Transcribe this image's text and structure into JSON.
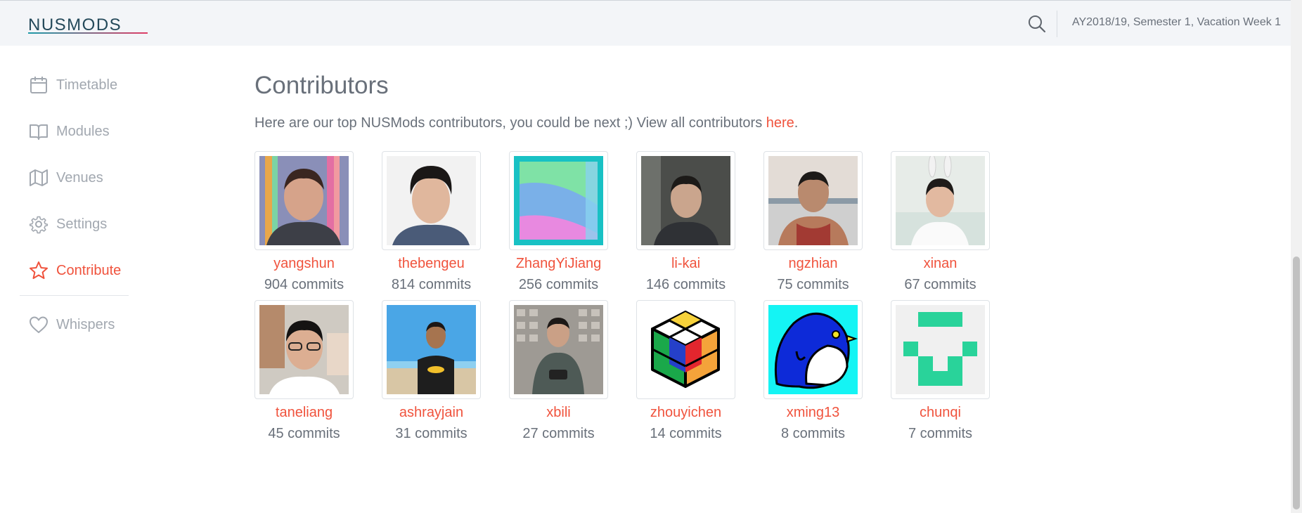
{
  "brand": {
    "logo_text": "NUSMODS",
    "accent": "#f0533d",
    "logo_gradient": [
      "#1e9aa8",
      "#e03d66"
    ]
  },
  "header": {
    "semester": "AY2018/19, Semester 1, Vacation Week 1",
    "search_icon": "search-icon"
  },
  "sidebar": {
    "items": [
      {
        "label": "Timetable",
        "icon": "calendar-icon",
        "active": false
      },
      {
        "label": "Modules",
        "icon": "book-icon",
        "active": false
      },
      {
        "label": "Venues",
        "icon": "map-icon",
        "active": false
      },
      {
        "label": "Settings",
        "icon": "gear-icon",
        "active": false
      },
      {
        "label": "Contribute",
        "icon": "star-icon",
        "active": true
      },
      {
        "label": "Whispers",
        "icon": "heart-icon",
        "active": false
      }
    ]
  },
  "main": {
    "title": "Contributors",
    "intro_text": "Here are our top NUSMods contributors, you could be next ;) View all contributors ",
    "intro_link": "here",
    "intro_end": ".",
    "contributors": [
      {
        "name": "yangshun",
        "commits": "904 commits"
      },
      {
        "name": "thebengeu",
        "commits": "814 commits"
      },
      {
        "name": "ZhangYiJiang",
        "commits": "256 commits"
      },
      {
        "name": "li-kai",
        "commits": "146 commits"
      },
      {
        "name": "ngzhian",
        "commits": "75 commits"
      },
      {
        "name": "xinan",
        "commits": "67 commits"
      },
      {
        "name": "taneliang",
        "commits": "45 commits"
      },
      {
        "name": "ashrayjain",
        "commits": "31 commits"
      },
      {
        "name": "xbili",
        "commits": "27 commits"
      },
      {
        "name": "zhouyichen",
        "commits": "14 commits"
      },
      {
        "name": "xming13",
        "commits": "8 commits"
      },
      {
        "name": "chunqi",
        "commits": "7 commits"
      }
    ]
  }
}
